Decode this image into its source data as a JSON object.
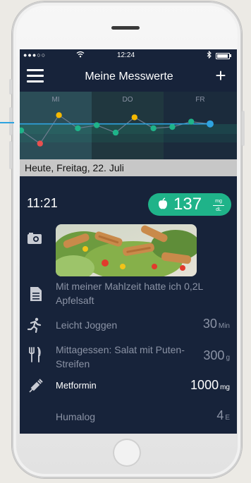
{
  "status_bar": {
    "signal": "●●●○○",
    "time": "12:24"
  },
  "navbar": {
    "title": "Meine Messwerte",
    "add_label": "+"
  },
  "chart_data": {
    "type": "line",
    "categories": [
      "MI",
      "DO",
      "FR"
    ],
    "bands": [
      "#2b4d57",
      "#20373f",
      "#1b2b3c"
    ],
    "series": [
      {
        "values": [
          0.5,
          0.2,
          0.85,
          0.55,
          0.62,
          0.45,
          0.8,
          0.55,
          0.58,
          0.7,
          0.65
        ]
      }
    ],
    "point_colors": [
      "#1fb389",
      "#e8504f",
      "#f5b800",
      "#1fb389",
      "#1fb389",
      "#1fb389",
      "#f5b800",
      "#1fb389",
      "#1fb389",
      "#1fb389",
      "#2ea3e0"
    ],
    "grid": false
  },
  "date_band": "Heute, Freitag, 22. Juli",
  "entry": {
    "time": "11:21",
    "glucose_value": "137",
    "glucose_unit_top": "mg",
    "glucose_unit_bottom": "dL",
    "note": "Mit meiner Mahlzeit hatte ich 0,2L Apfelsaft",
    "activity_label": "Leicht Joggen",
    "activity_value": "30",
    "activity_unit": "Min",
    "meal_label": "Mittagessen: Salat mit Puten-Streifen",
    "meal_value": "300",
    "meal_unit": "g",
    "med1_label": "Metformin",
    "med1_value": "1000",
    "med1_unit": "mg",
    "med2_label": "Humalog",
    "med2_value": "4",
    "med2_unit": "E"
  },
  "colors": {
    "screen_bg": "#17233a",
    "accent_green": "#1fb389",
    "accent_blue": "#2ea3e0",
    "muted_text": "#8b93a5"
  },
  "icons": [
    "hamburger-icon",
    "plus-icon",
    "camera-icon",
    "note-icon",
    "runner-icon",
    "cutlery-icon",
    "syringe-icon",
    "apple-icon"
  ]
}
